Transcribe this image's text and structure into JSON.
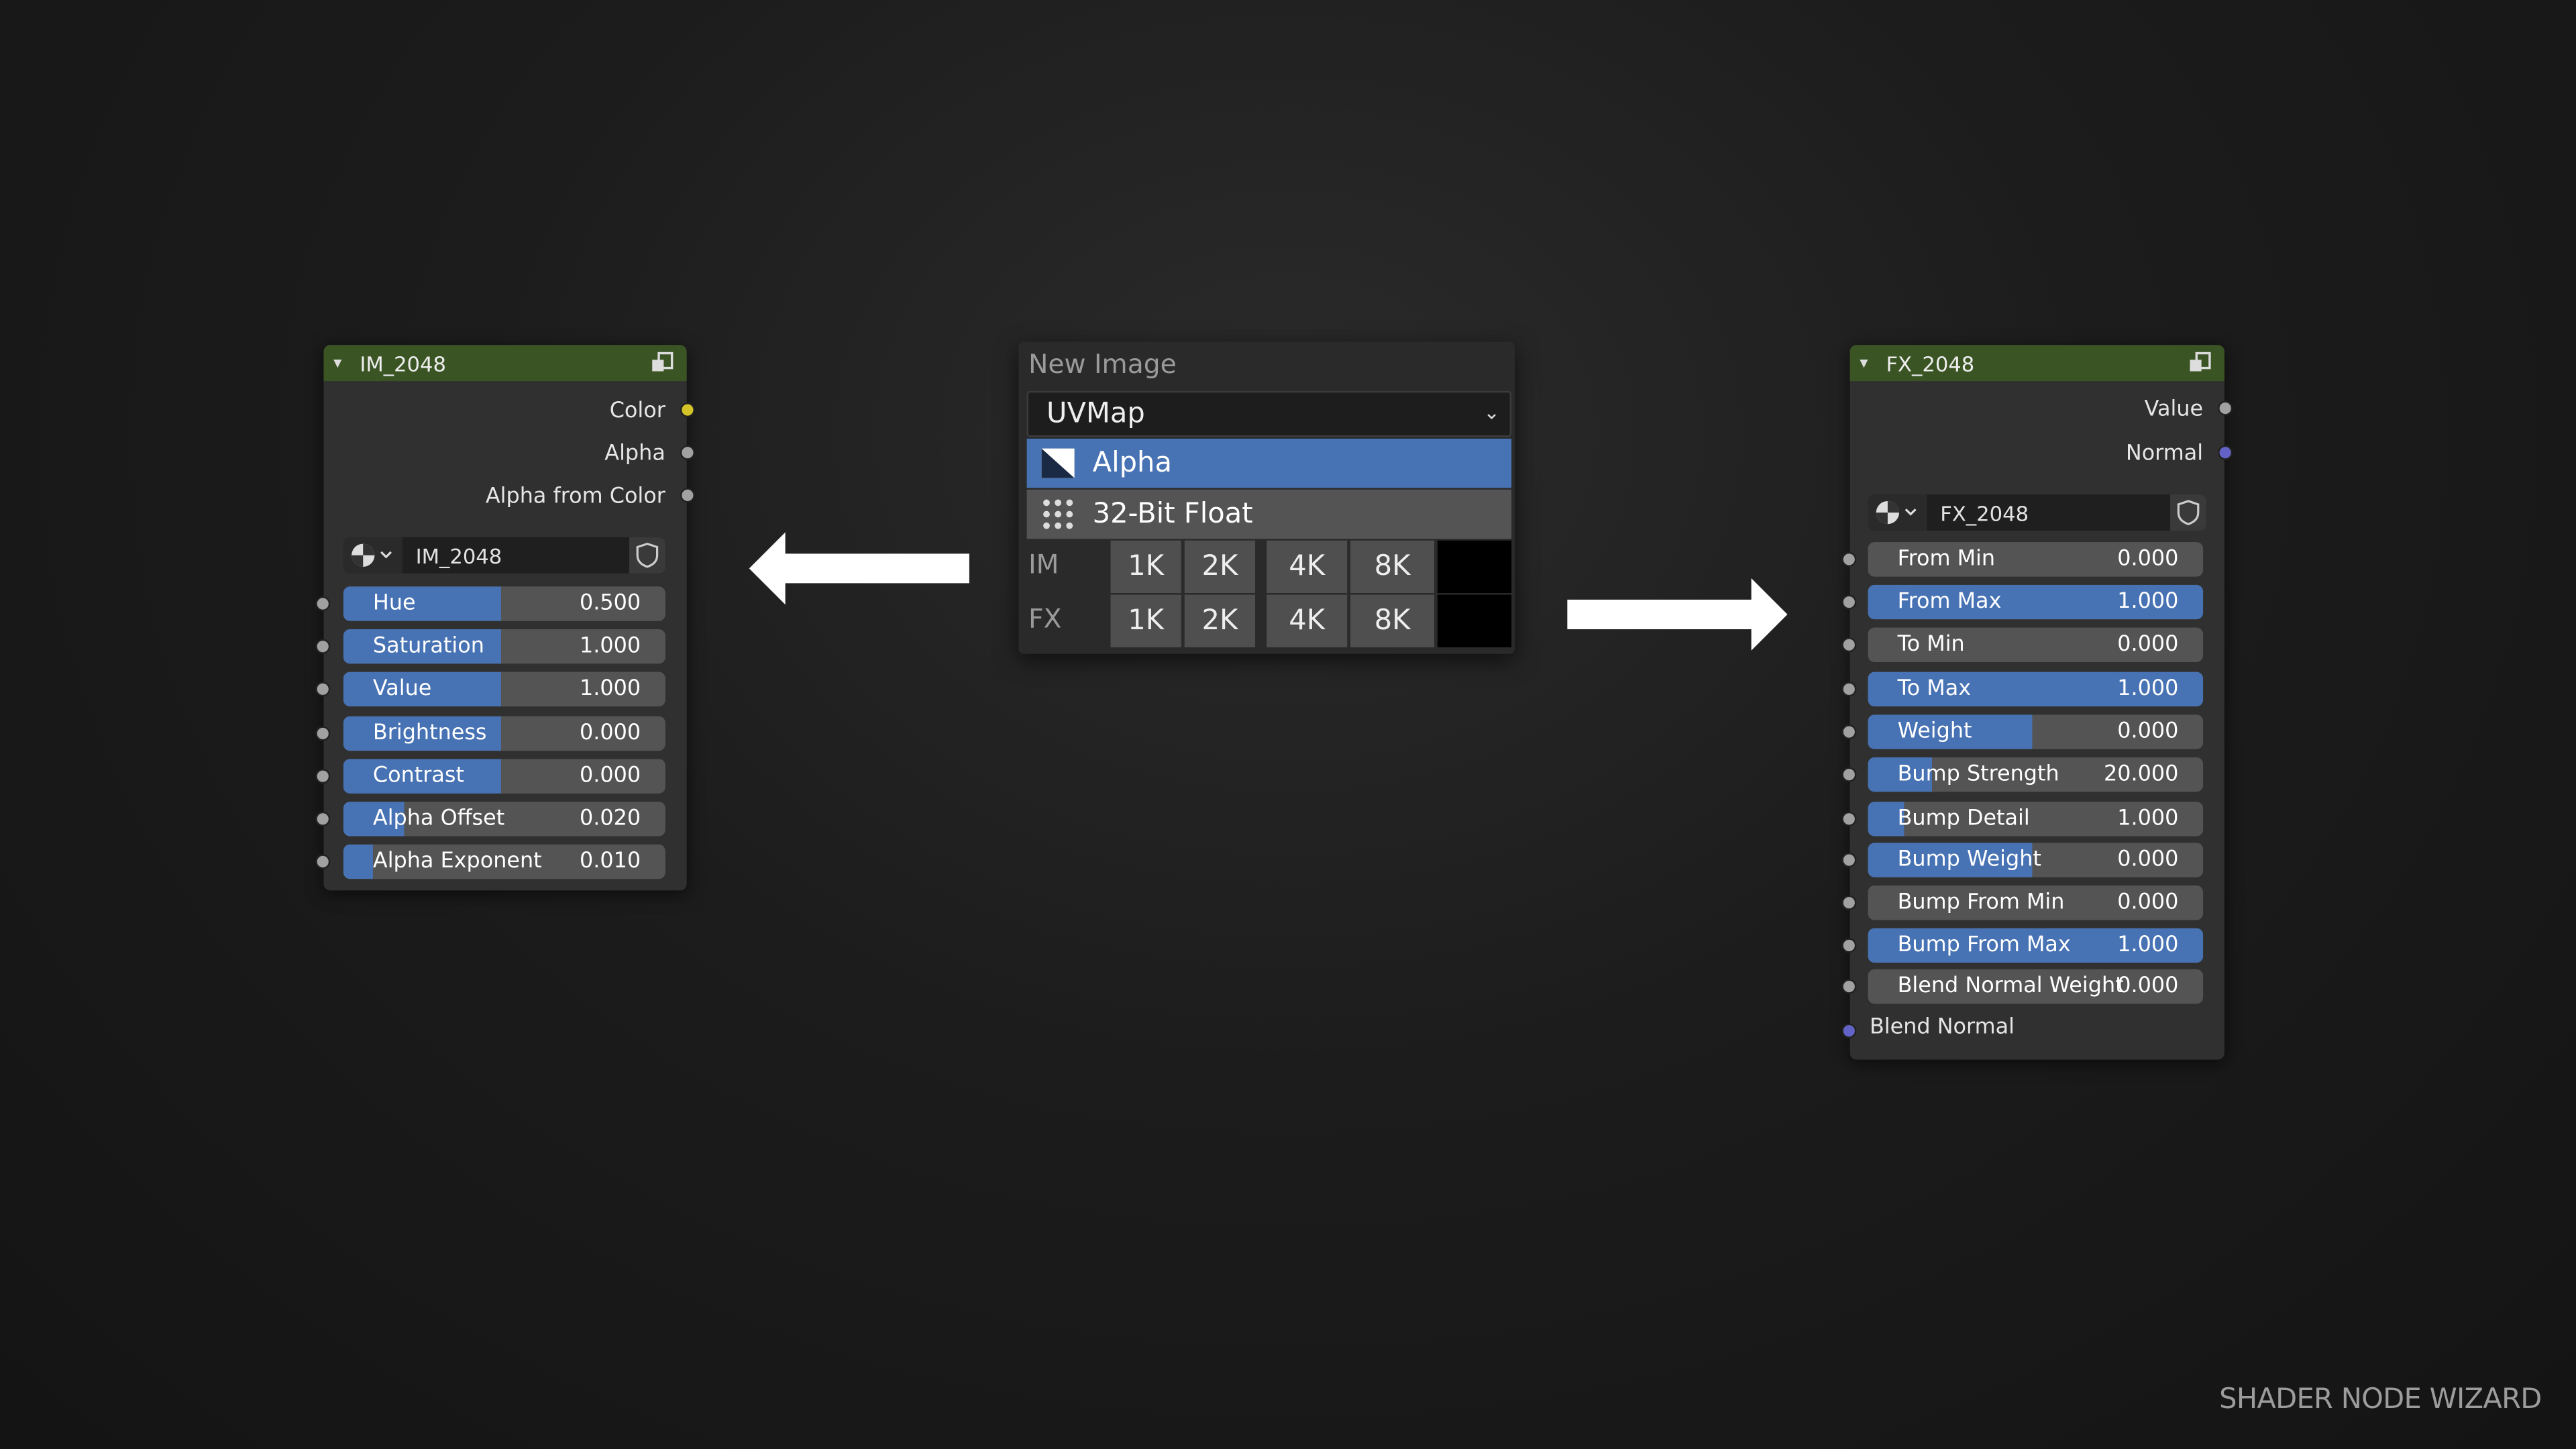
{
  "left_node": {
    "title": "IM_2048",
    "outputs": [
      {
        "label": "Color",
        "socket_color": "#d4c427"
      },
      {
        "label": "Alpha",
        "socket_color": "#a1a1a1"
      },
      {
        "label": "Alpha from Color",
        "socket_color": "#a1a1a1"
      }
    ],
    "image_name": "IM_2048",
    "fields": [
      {
        "label": "Hue",
        "value": "0.500",
        "fill": 0.49
      },
      {
        "label": "Saturation",
        "value": "1.000",
        "fill": 0.49
      },
      {
        "label": "Value",
        "value": "1.000",
        "fill": 0.49
      },
      {
        "label": "Brightness",
        "value": "0.000",
        "fill": 0.49
      },
      {
        "label": "Contrast",
        "value": "0.000",
        "fill": 0.49
      },
      {
        "label": "Alpha Offset",
        "value": "0.020",
        "fill": 0.19
      },
      {
        "label": "Alpha Exponent",
        "value": "0.010",
        "fill": 0.09
      }
    ]
  },
  "popup": {
    "title": "New Image",
    "uv_map": "UVMap",
    "selected_option": "Alpha",
    "float_option": "32-Bit Float",
    "rows": [
      {
        "label": "IM",
        "buttons": [
          "1K",
          "2K",
          "4K",
          "8K"
        ]
      },
      {
        "label": "FX",
        "buttons": [
          "1K",
          "2K",
          "4K",
          "8K"
        ]
      }
    ],
    "accent_color": "#4772b3"
  },
  "right_node": {
    "title": "FX_2048",
    "outputs": [
      {
        "label": "Value",
        "socket_color": "#a1a1a1"
      },
      {
        "label": "Normal",
        "socket_color": "#6363c7"
      }
    ],
    "image_name": "FX_2048",
    "fields": [
      {
        "label": "From Min",
        "value": "0.000",
        "fill": 0.0
      },
      {
        "label": "From Max",
        "value": "1.000",
        "fill": 1.0
      },
      {
        "label": "To Min",
        "value": "0.000",
        "fill": 0.0
      },
      {
        "label": "To Max",
        "value": "1.000",
        "fill": 1.0
      },
      {
        "label": "Weight",
        "value": "0.000",
        "fill": 0.49
      },
      {
        "label": "Bump Strength",
        "value": "20.000",
        "fill": 0.19
      },
      {
        "label": "Bump Detail",
        "value": "1.000",
        "fill": 0.11
      },
      {
        "label": "Bump Weight",
        "value": "0.000",
        "fill": 0.49
      },
      {
        "label": "Bump From Min",
        "value": "0.000",
        "fill": 0.0
      },
      {
        "label": "Bump From Max",
        "value": "1.000",
        "fill": 1.0
      },
      {
        "label": "Blend Normal Weight",
        "value": "0.000",
        "fill": 0.0
      }
    ],
    "blend_normal_label": "Blend Normal"
  },
  "branding": "SHADER NODE WIZARD",
  "header_color": "#3b5424"
}
